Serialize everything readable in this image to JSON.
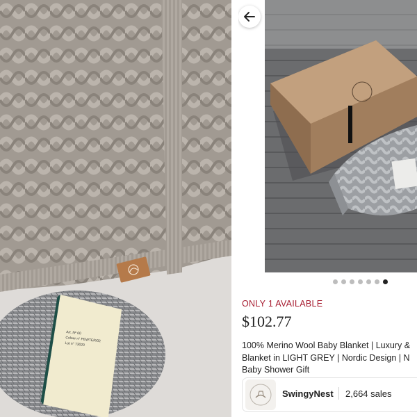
{
  "listing": {
    "availability": "ONLY 1 AVAILABLE",
    "price": "$102.77",
    "title": "100% Merino Wool Baby Blanket | Luxury &\nBlanket in LIGHT GREY | Nordic Design | N\nBaby Shower Gift",
    "carousel": {
      "count": 7,
      "active_index": 6
    }
  },
  "shop": {
    "name": "SwingyNest",
    "sales": "2,664 sales"
  },
  "left_photo": {
    "yarn_label": {
      "art": "Art. Nº  60",
      "color": "Colour n°  PEWTER/02",
      "lot": "Lot n°  73020"
    }
  },
  "icons": {
    "back": "arrow-left-icon",
    "leather_tag": "rocking-horse-logo-icon"
  },
  "colors": {
    "availability": "#a61a2e",
    "dot_active": "#222222",
    "dot_inactive": "#bdbdbd"
  }
}
